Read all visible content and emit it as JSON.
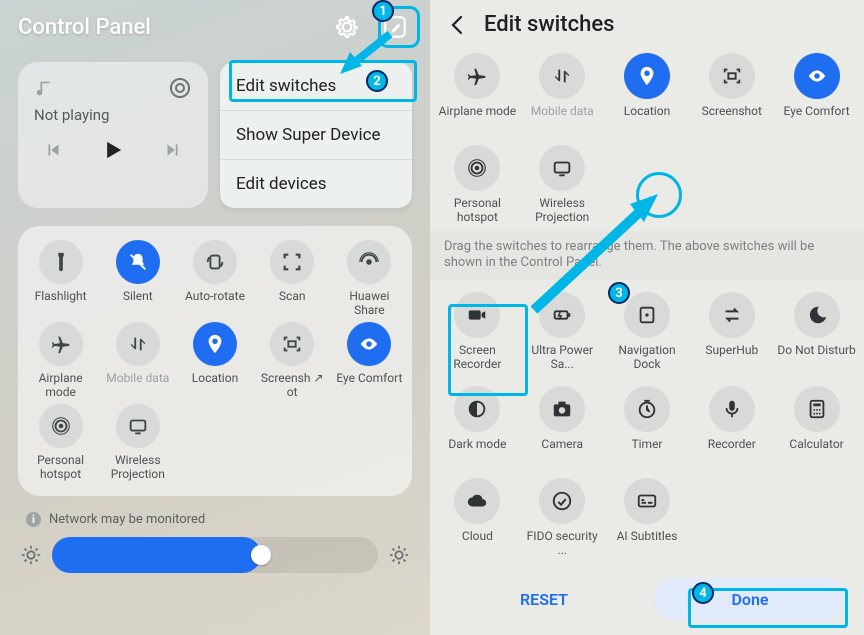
{
  "left": {
    "title": "Control Panel",
    "media": {
      "status": "Not playing"
    },
    "popup": [
      "Edit switches",
      "Show Super Device",
      "Edit devices"
    ],
    "switches_row1": [
      {
        "label": "Flashlight",
        "icon": "flashlight"
      },
      {
        "label": "Silent",
        "icon": "silent",
        "active": true
      },
      {
        "label": "Auto-rotate",
        "icon": "rotate"
      },
      {
        "label": "Scan",
        "icon": "scan"
      },
      {
        "label": "Huawei Share",
        "icon": "share"
      }
    ],
    "switches_row2": [
      {
        "label": "Airplane mode",
        "icon": "airplane"
      },
      {
        "label": "Mobile data",
        "icon": "mobiledata",
        "muted": true
      },
      {
        "label": "Location",
        "icon": "location",
        "active": true
      },
      {
        "label": "Screensh ↗\not",
        "icon": "screenshot"
      },
      {
        "label": "Eye Comfort",
        "icon": "eye",
        "active": true
      }
    ],
    "switches_row3": [
      {
        "label": "Personal hotspot",
        "icon": "hotspot"
      },
      {
        "label": "Wireless Projection",
        "icon": "projection"
      }
    ],
    "net_note": "Network may be monitored"
  },
  "right": {
    "title": "Edit switches",
    "top": [
      {
        "label": "Airplane mode",
        "icon": "airplane"
      },
      {
        "label": "Mobile data",
        "icon": "mobiledata",
        "muted": true
      },
      {
        "label": "Location",
        "icon": "location",
        "active": true
      },
      {
        "label": "Screenshot",
        "icon": "screenshot"
      },
      {
        "label": "Eye Comfort",
        "icon": "eye",
        "active": true
      },
      {
        "label": "Personal hotspot",
        "icon": "hotspot"
      },
      {
        "label": "Wireless Projection",
        "icon": "projection"
      }
    ],
    "hint": "Drag the switches to rearrange them. The above switches will be shown in the Control Panel.",
    "bottom": [
      {
        "label": "Screen Recorder",
        "icon": "recorder"
      },
      {
        "label": "Ultra Power Sa...",
        "icon": "battery"
      },
      {
        "label": "Navigation Dock",
        "icon": "navdock"
      },
      {
        "label": "SuperHub",
        "icon": "loop"
      },
      {
        "label": "Do Not Disturb",
        "icon": "moon"
      },
      {
        "label": "Dark mode",
        "icon": "darkmode"
      },
      {
        "label": "Camera",
        "icon": "camera"
      },
      {
        "label": "Timer",
        "icon": "timer"
      },
      {
        "label": "Recorder",
        "icon": "mic"
      },
      {
        "label": "Calculator",
        "icon": "calc"
      },
      {
        "label": "Cloud",
        "icon": "cloud"
      },
      {
        "label": "FIDO security ...",
        "icon": "fido"
      },
      {
        "label": "AI Subtitles",
        "icon": "subtitles"
      }
    ],
    "reset": "RESET",
    "done": "Done"
  },
  "annotations": {
    "b1": "1",
    "b2": "2",
    "b3": "3",
    "b4": "4"
  }
}
